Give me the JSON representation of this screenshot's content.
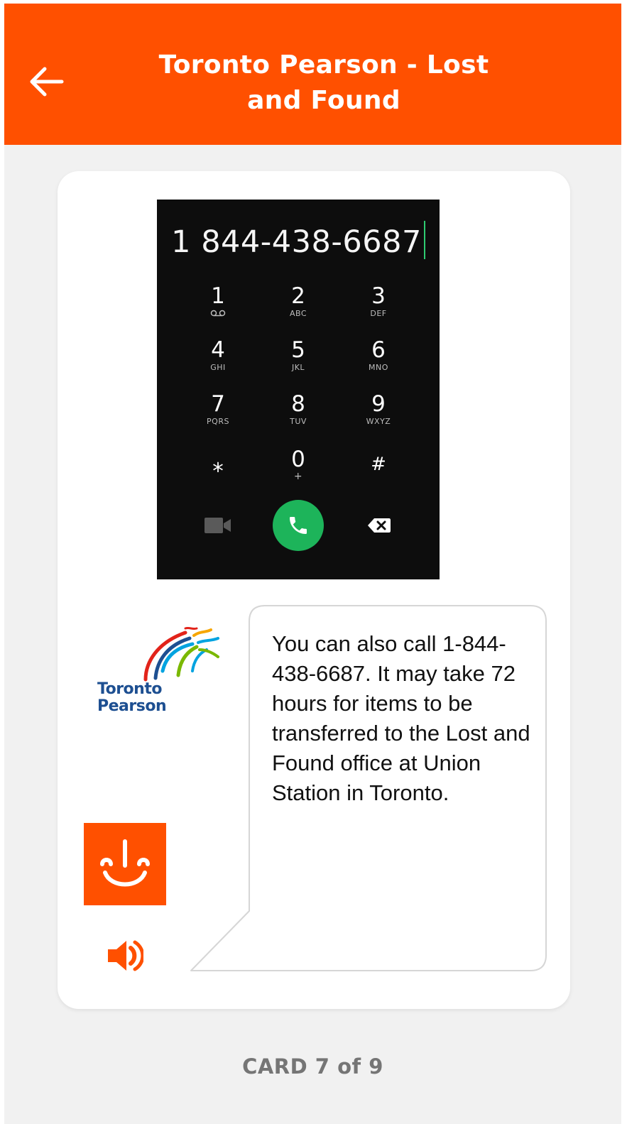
{
  "header": {
    "title_line1": "Toronto Pearson - Lost",
    "title_line2": "and Found",
    "back_icon": "arrow-left-icon",
    "background": "#ff5000"
  },
  "dialer": {
    "number": "1 844-438-6687",
    "keys": [
      {
        "digit": "1",
        "letters": ""
      },
      {
        "digit": "2",
        "letters": "ABC"
      },
      {
        "digit": "3",
        "letters": "DEF"
      },
      {
        "digit": "4",
        "letters": "GHI"
      },
      {
        "digit": "5",
        "letters": "JKL"
      },
      {
        "digit": "6",
        "letters": "MNO"
      },
      {
        "digit": "7",
        "letters": "PQRS"
      },
      {
        "digit": "8",
        "letters": "TUV"
      },
      {
        "digit": "9",
        "letters": "WXYZ"
      },
      {
        "digit": "⁎",
        "letters": ""
      },
      {
        "digit": "0",
        "letters": "+"
      },
      {
        "digit": "#",
        "letters": ""
      }
    ],
    "call_button_color": "#1db45a"
  },
  "logo": {
    "line1": "Toronto",
    "line2": "Pearson"
  },
  "message": {
    "text": "You can also call 1-844-438-6687. It may take 72 hours for items to be transferred to the Lost and Found office at Union Station in Toronto."
  },
  "assistant": {
    "avatar_icon": "smiling-face-icon",
    "speaker_icon": "speaker-icon"
  },
  "footer": {
    "counter": "CARD 7 of 9"
  }
}
